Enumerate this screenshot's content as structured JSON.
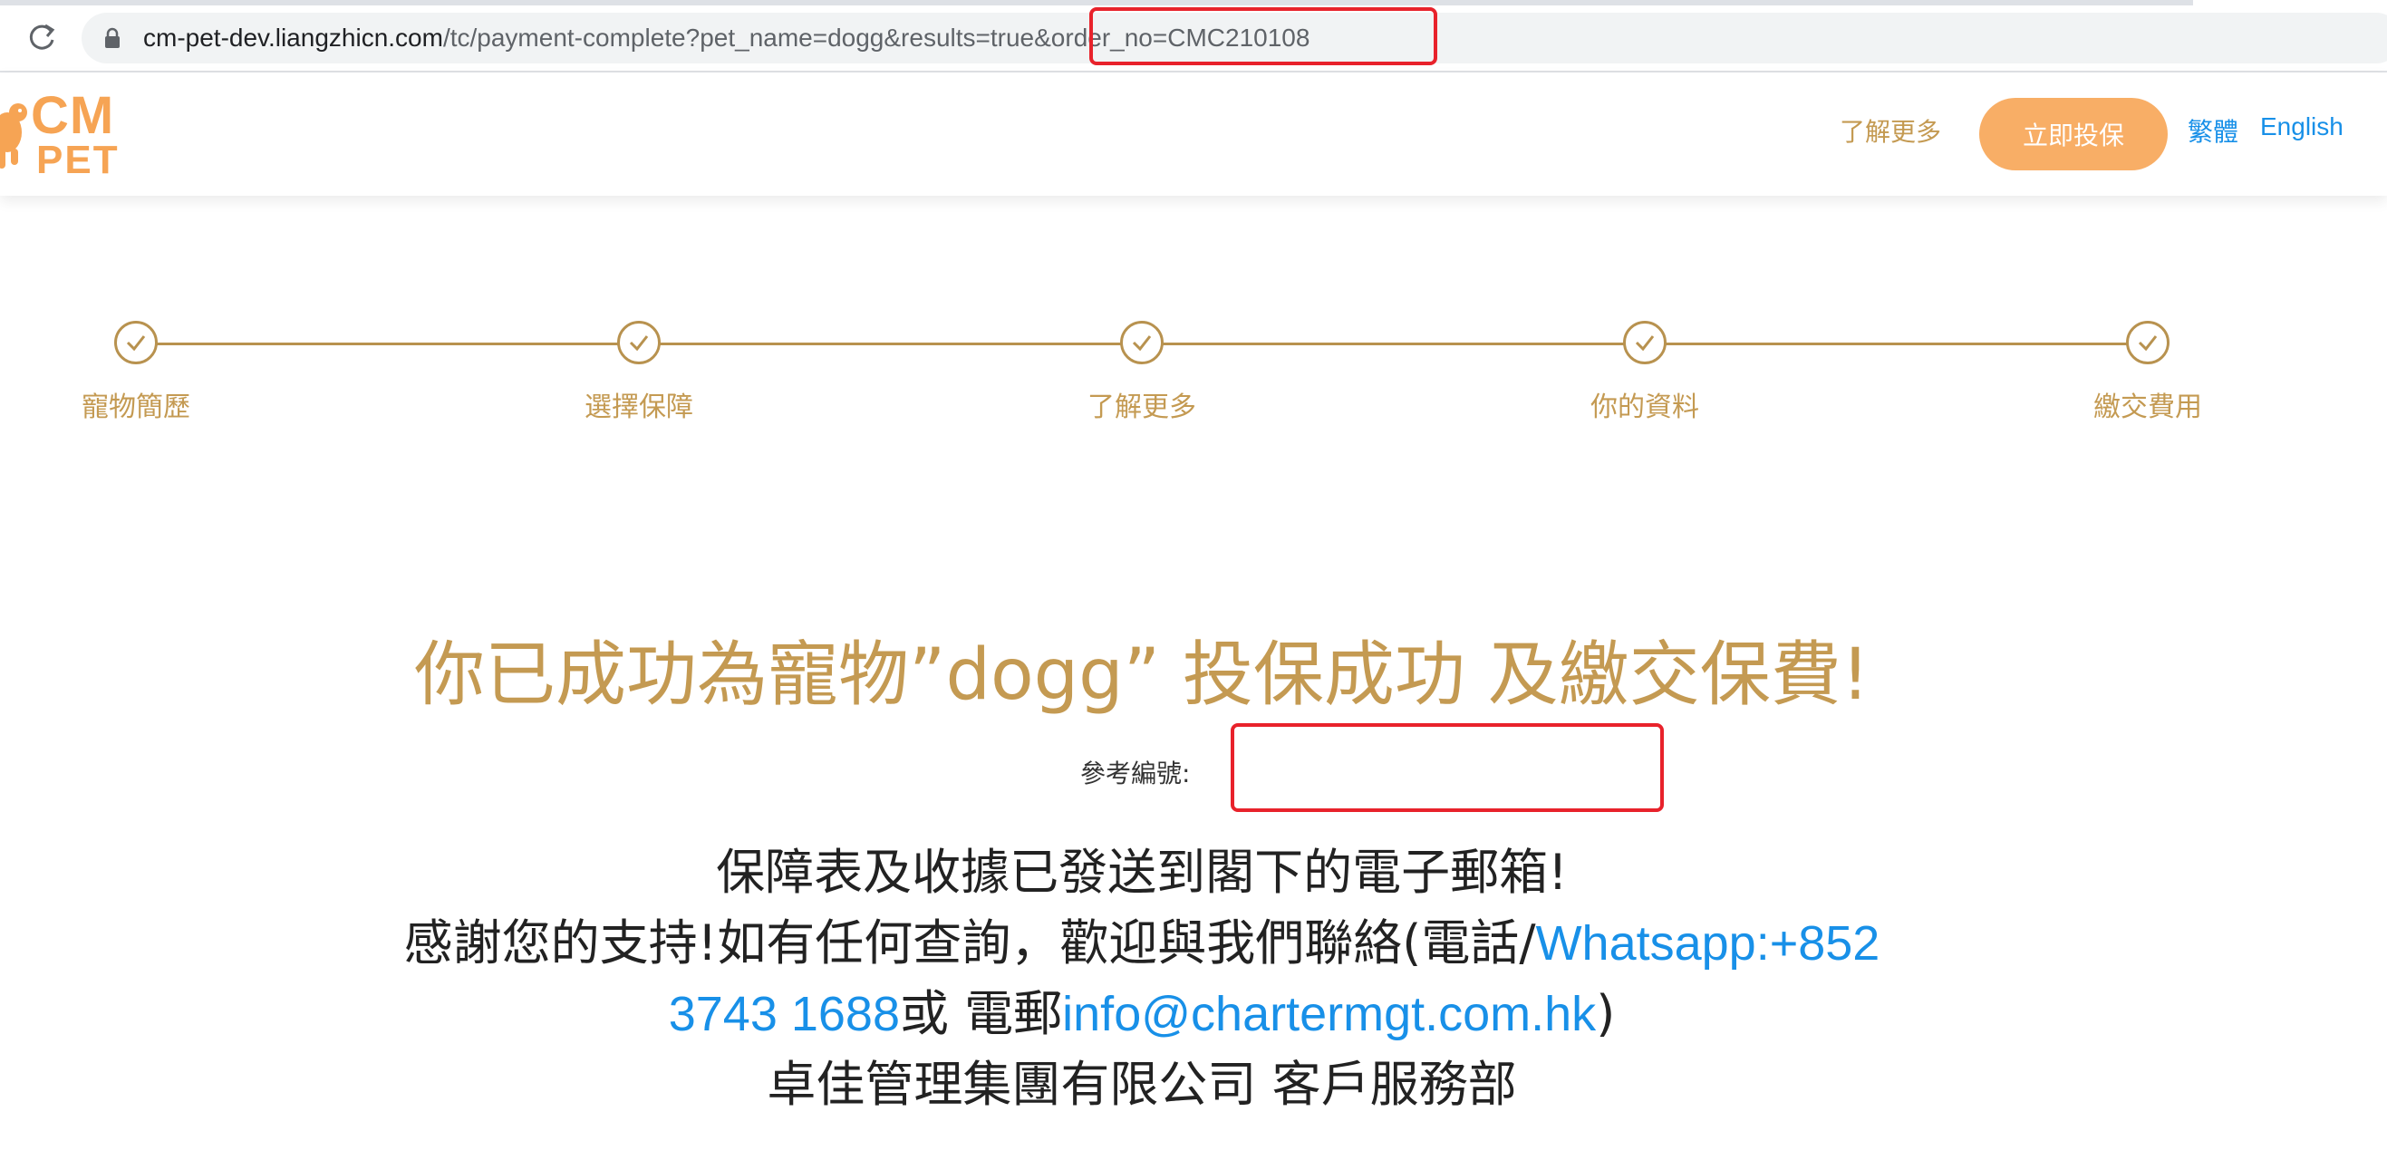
{
  "browser": {
    "url_host": "cm-pet-dev.liangzhicn.com",
    "url_path": "/tc/payment-complete?pet_name=dogg&results=true&order_no=CMC210108"
  },
  "header": {
    "logo_cm": "CM",
    "logo_pet": "PET",
    "nav_more": "了解更多",
    "cta_label": "立即投保",
    "lang_tc": "繁體",
    "lang_en": "English"
  },
  "steps": [
    {
      "label": "寵物簡歷"
    },
    {
      "label": "選擇保障"
    },
    {
      "label": "了解更多"
    },
    {
      "label": "你的資料"
    },
    {
      "label": "繳交費用"
    }
  ],
  "message": {
    "headline": "你已成功為寵物”dogg” 投保成功 及繳交保費!",
    "ref_label": "參考編號:",
    "line1": "保障表及收據已發送到閣下的電子郵箱!",
    "line2_text": "感謝您的支持!如有任何查詢，歡迎與我們聯絡(電話/",
    "line2_link": "Whatsapp:+852",
    "line3_link": "3743 1688",
    "line3_mid": "或 電郵",
    "line3_email": "info@chartermgt.com.hk",
    "line3_end": ")",
    "line4": "卓佳管理集團有限公司 客戶服務部"
  },
  "colors": {
    "gold": "#c49a52",
    "orange": "#f8ae66",
    "link_blue": "#1890e8",
    "highlight_red": "#e8222b"
  }
}
